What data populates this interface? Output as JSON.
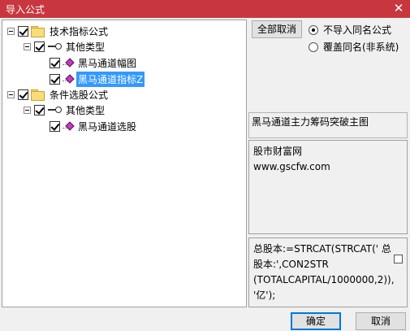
{
  "window": {
    "title": "导入公式",
    "close_glyph": "✕"
  },
  "tree": {
    "nodes": [
      {
        "label": "技术指标公式",
        "icon": "folder-icon",
        "checked": true,
        "expanded": true
      },
      {
        "label": "其他类型",
        "icon": "key-icon",
        "checked": true,
        "expanded": true
      },
      {
        "label": "黑马通道幅图",
        "icon": "formula-icon",
        "checked": true
      },
      {
        "label": "黑马通道指标Z",
        "icon": "formula-icon",
        "checked": true,
        "selected": true
      },
      {
        "label": "条件选股公式",
        "icon": "folder-icon",
        "checked": true,
        "expanded": true
      },
      {
        "label": "其他类型",
        "icon": "key-icon",
        "checked": true,
        "expanded": true
      },
      {
        "label": "黑马通道选股",
        "icon": "formula-icon",
        "checked": true
      }
    ]
  },
  "options": {
    "deselect_all_label": "全部取消",
    "radio_skip_label": "不导入同名公式",
    "radio_overwrite_label": "覆盖同名(非系统)",
    "selected_radio": "skip"
  },
  "description": "黑马通道主力筹码突破主图",
  "source": {
    "line1": "股市财富网",
    "line2": "www.gscfw.com"
  },
  "formula": {
    "line1": "总股本:=STRCAT(STRCAT(' 总",
    "line2": "股本:',CON2STR",
    "line3": "(TOTALCAPITAL/1000000,2)),",
    "line4": "'亿');"
  },
  "footer": {
    "ok_label": "确定",
    "cancel_label": "取消"
  },
  "colors": {
    "titlebar": "#c8373f",
    "selection": "#3399ff",
    "formula_icon": "#c03cc0",
    "folder": "#f8dc7a"
  }
}
